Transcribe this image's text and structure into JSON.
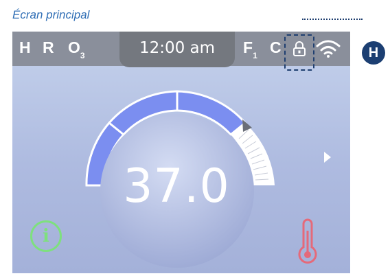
{
  "caption": "Écran principal",
  "status": {
    "h": "H",
    "r": "R",
    "o": "O",
    "o_sub": "3",
    "time": "12:00 am",
    "f": "F",
    "f_sub": "1",
    "c": "C"
  },
  "callout": "H",
  "temperature": "37.0",
  "icons": {
    "lock": "lock-icon",
    "wifi": "wifi-icon",
    "info": "info-icon",
    "thermometer": "thermometer-icon",
    "arrow": "arrow-right-icon"
  },
  "info_glyph": "i",
  "colors": {
    "accent": "#7b8ef0",
    "info": "#7ee07e",
    "thermo": "#e56a7a",
    "callout": "#1c3f72"
  }
}
